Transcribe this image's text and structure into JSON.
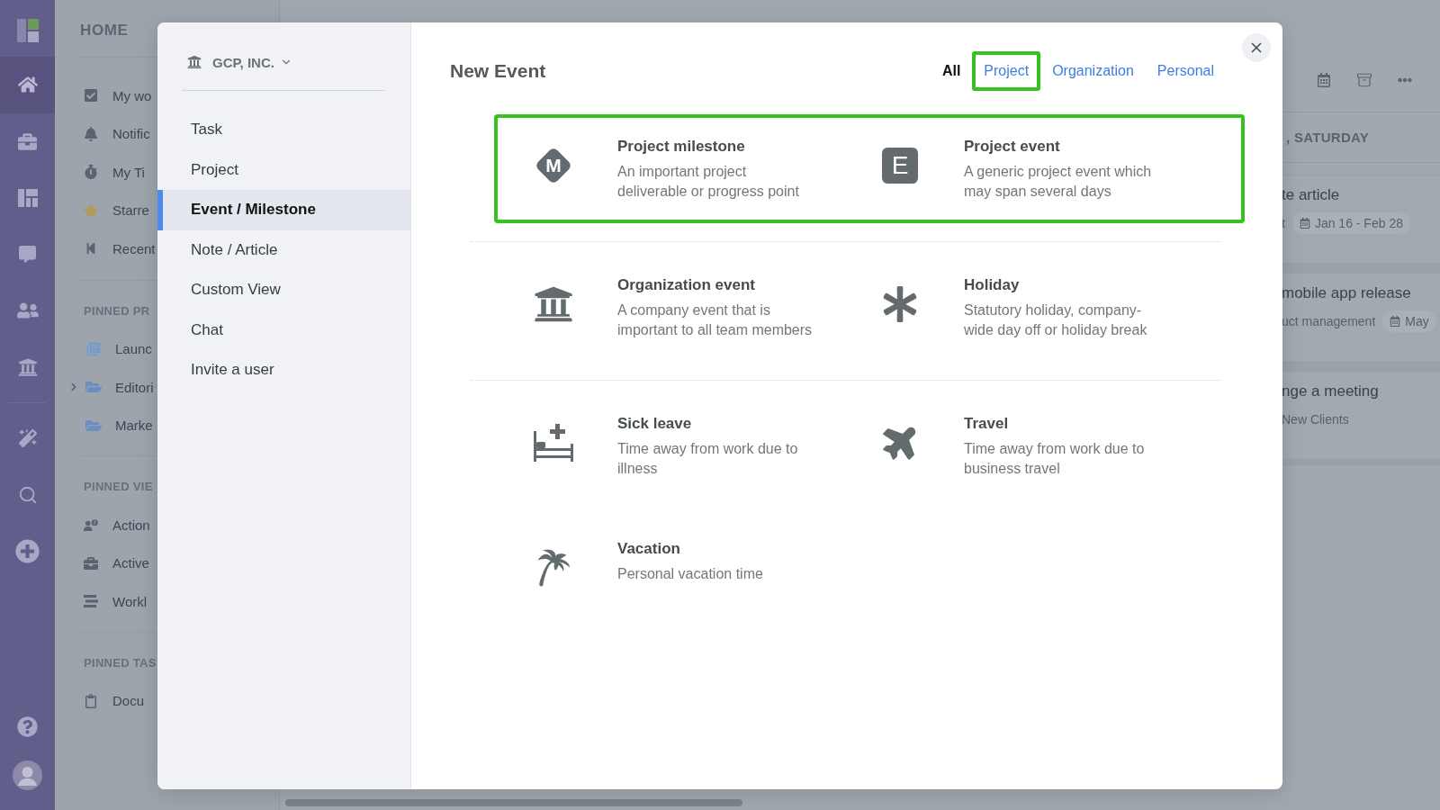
{
  "nav_rail": {
    "items": [
      {
        "selected": true
      },
      {
        "selected": false
      },
      {
        "selected": false
      },
      {
        "selected": false
      },
      {
        "selected": false
      },
      {
        "selected": false
      }
    ]
  },
  "sidebar": {
    "title": "HOME",
    "items": [
      {
        "label": "My wo"
      },
      {
        "label": "Notific"
      },
      {
        "label": "My Ti"
      },
      {
        "label": "Starre"
      },
      {
        "label": "Recent"
      }
    ],
    "sections": [
      {
        "heading": "PINNED PR",
        "items": [
          {
            "label": "Launc",
            "has_children": false
          },
          {
            "label": "Editori",
            "has_children": true
          },
          {
            "label": "Marke",
            "has_children": false
          }
        ]
      },
      {
        "heading": "PINNED VIE",
        "items": [
          {
            "label": "Action"
          },
          {
            "label": "Active"
          },
          {
            "label": "Workl"
          }
        ]
      },
      {
        "heading": "PINNED TAS",
        "items": [
          {
            "label": "Docu"
          }
        ]
      }
    ]
  },
  "feed": {
    "day_heading": ", SATURDAY",
    "cards": [
      {
        "title": "te article",
        "meta": "t",
        "date": "Jan 16 - Feb 28"
      },
      {
        "title": "mobile app release",
        "meta": "uct management",
        "date": "May"
      },
      {
        "title": "nge a meeting",
        "meta": "New Clients"
      }
    ]
  },
  "modal": {
    "organization": "GCP, INC.",
    "menu": [
      {
        "label": "Task",
        "selected": false
      },
      {
        "label": "Project",
        "selected": false
      },
      {
        "label": "Event / Milestone",
        "selected": true
      },
      {
        "label": "Note / Article",
        "selected": false
      },
      {
        "label": "Custom View",
        "selected": false
      },
      {
        "label": "Chat",
        "selected": false
      },
      {
        "label": "Invite a user",
        "selected": false
      }
    ],
    "title": "New Event",
    "filters": [
      {
        "label": "All",
        "selected": true,
        "highlighted": false
      },
      {
        "label": "Project",
        "selected": false,
        "highlighted": true
      },
      {
        "label": "Organization",
        "selected": false,
        "highlighted": false
      },
      {
        "label": "Personal",
        "selected": false,
        "highlighted": false
      }
    ],
    "groups": [
      {
        "highlighted": true,
        "items": [
          {
            "kind": "milestone",
            "badge": "M",
            "title": "Project milestone",
            "description": "An important project deliverable or progress point"
          },
          {
            "kind": "project",
            "badge": "E",
            "title": "Project event",
            "description": "A generic project event which may span several days"
          }
        ]
      },
      {
        "highlighted": false,
        "items": [
          {
            "kind": "organization",
            "title": "Organization event",
            "description": "A company event that is important to all team members"
          },
          {
            "kind": "holiday",
            "title": "Holiday",
            "description": "Statutory holiday, company-wide day off or holiday break"
          }
        ]
      },
      {
        "highlighted": false,
        "items": [
          {
            "kind": "sick",
            "title": "Sick leave",
            "description": "Time away from work due to illness"
          },
          {
            "kind": "travel",
            "title": "Travel",
            "description": "Time away from work due to business travel"
          },
          {
            "kind": "vacation",
            "title": "Vacation",
            "description": "Personal vacation time"
          }
        ]
      }
    ]
  }
}
